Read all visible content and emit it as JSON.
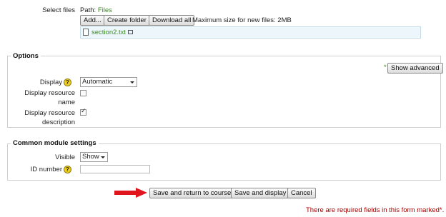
{
  "select_files": {
    "label": "Select files",
    "path_label": "Path:",
    "path_value": "Files",
    "add_button": "Add...",
    "create_folder_button": "Create folder",
    "download_all_button": "Download all",
    "max_size_text": "Maximum size for new files: 2MB",
    "file_name": "section2.txt"
  },
  "options": {
    "legend": "Options",
    "required_star": "*",
    "show_advanced_button": "Show advanced",
    "display_label": "Display",
    "display_value": "Automatic",
    "display_resource_name_label": "Display resource name",
    "display_resource_name_checked": false,
    "display_resource_description_label": "Display resource description",
    "display_resource_description_checked": true
  },
  "common": {
    "legend": "Common module settings",
    "visible_label": "Visible",
    "visible_value": "Show",
    "id_number_label": "ID number",
    "id_number_value": ""
  },
  "actions": {
    "save_return_button": "Save and return to course",
    "save_display_button": "Save and display",
    "cancel_button": "Cancel"
  },
  "footer": {
    "required_note": "There are required fields in this form marked",
    "required_star": "*."
  },
  "colors": {
    "link_green": "#3b8c20",
    "required_red": "#aa0000",
    "arrow_red": "#e0141c",
    "file_area_bg": "#edf6fb"
  }
}
